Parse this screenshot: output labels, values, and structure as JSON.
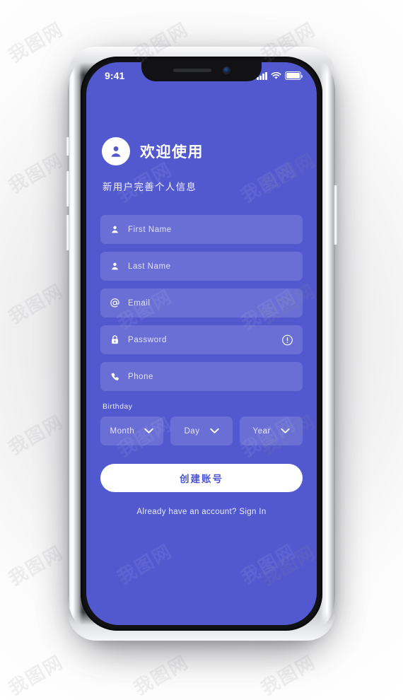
{
  "status_bar": {
    "time": "9:41",
    "signal_icon": "signal-bars-icon",
    "wifi_icon": "wifi-icon",
    "battery_icon": "battery-icon"
  },
  "header": {
    "avatar_icon": "user-avatar-icon",
    "title": "欢迎使用",
    "subtitle": "新用户完善个人信息"
  },
  "form": {
    "fields": [
      {
        "name": "first-name",
        "placeholder": "First Name",
        "icon": "person-icon",
        "value": ""
      },
      {
        "name": "last-name",
        "placeholder": "Last Name",
        "icon": "person-icon",
        "value": ""
      },
      {
        "name": "email",
        "placeholder": "Email",
        "icon": "at-sign-icon",
        "value": ""
      },
      {
        "name": "password",
        "placeholder": "Password",
        "icon": "lock-icon",
        "value": "",
        "trailing_icon": "exclamation-circle-icon"
      },
      {
        "name": "phone",
        "placeholder": "Phone",
        "icon": "phone-icon",
        "value": ""
      }
    ],
    "birthday_label": "Birthday",
    "birthday_selects": [
      {
        "name": "month",
        "value": "Month",
        "icon": "chevron-down-icon"
      },
      {
        "name": "day",
        "value": "Day",
        "icon": "chevron-down-icon"
      },
      {
        "name": "year",
        "value": "Year",
        "icon": "chevron-down-icon"
      }
    ]
  },
  "actions": {
    "create_account_label": "创建账号",
    "signin_prompt": "Already have an account? Sign In"
  },
  "theme": {
    "screen_background": "#5259CF",
    "field_background": "#6670D8",
    "button_background": "#FFFFFF",
    "button_text": "#4D56D3",
    "text_primary": "#FFFFFF"
  },
  "watermark": {
    "text": "我图网"
  }
}
